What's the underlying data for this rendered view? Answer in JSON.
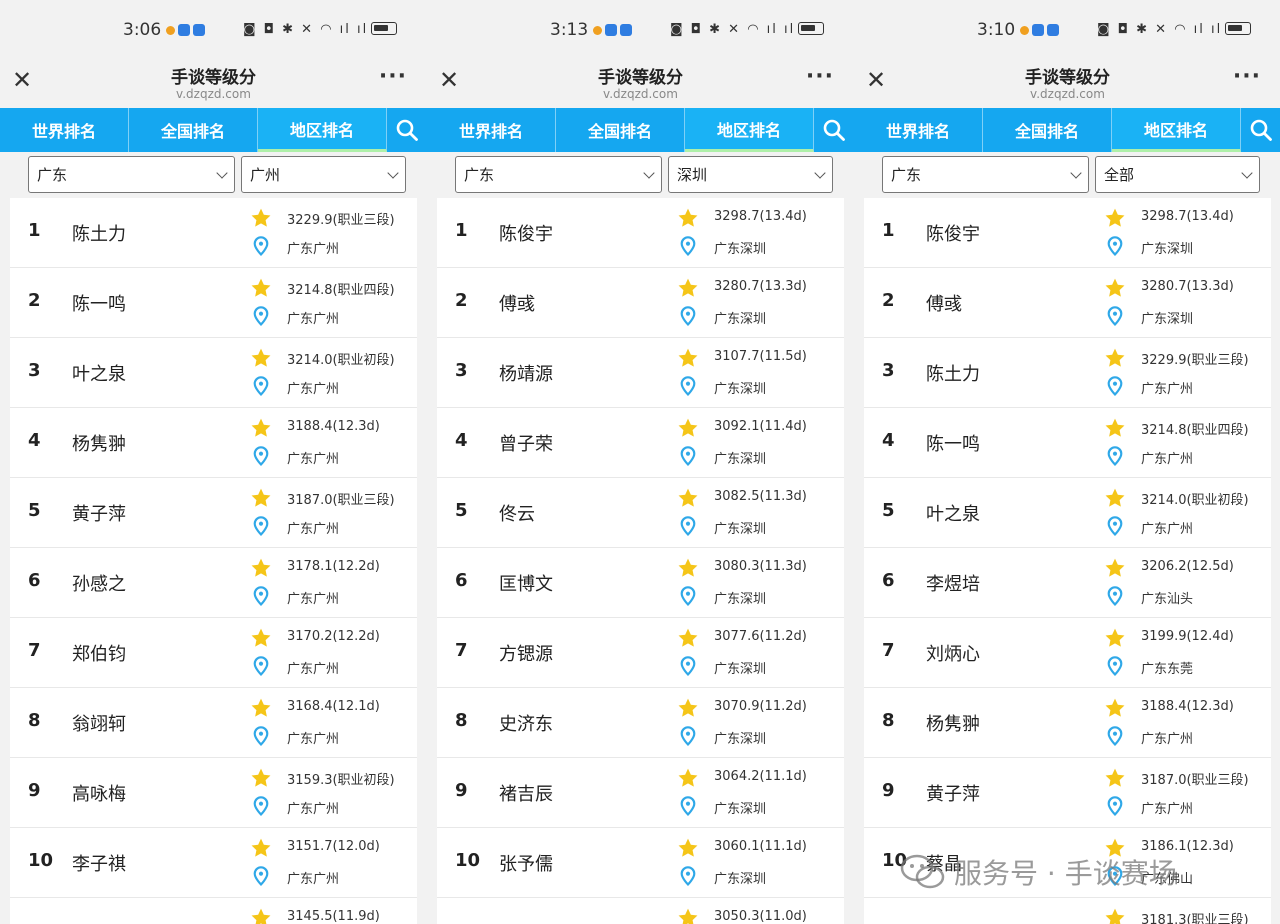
{
  "panels": [
    {
      "status_time": "3:06",
      "title": "手谈等级分",
      "url": "v.dzqzd.com",
      "tabs": [
        "世界排名",
        "全国排名",
        "地区排名"
      ],
      "active_tab": 2,
      "province": "广东",
      "city": "广州",
      "rows": [
        {
          "rank": "1",
          "name": "陈土力",
          "score": "3229.9(职业三段)",
          "loc": "广东广州"
        },
        {
          "rank": "2",
          "name": "陈一鸣",
          "score": "3214.8(职业四段)",
          "loc": "广东广州"
        },
        {
          "rank": "3",
          "name": "叶之泉",
          "score": "3214.0(职业初段)",
          "loc": "广东广州"
        },
        {
          "rank": "4",
          "name": "杨隽翀",
          "score": "3188.4(12.3d)",
          "loc": "广东广州"
        },
        {
          "rank": "5",
          "name": "黄子萍",
          "score": "3187.0(职业三段)",
          "loc": "广东广州"
        },
        {
          "rank": "6",
          "name": "孙感之",
          "score": "3178.1(12.2d)",
          "loc": "广东广州"
        },
        {
          "rank": "7",
          "name": "郑伯钧",
          "score": "3170.2(12.2d)",
          "loc": "广东广州"
        },
        {
          "rank": "8",
          "name": "翁翊轲",
          "score": "3168.4(12.1d)",
          "loc": "广东广州"
        },
        {
          "rank": "9",
          "name": "高咏梅",
          "score": "3159.3(职业初段)",
          "loc": "广东广州"
        },
        {
          "rank": "10",
          "name": "李子祺",
          "score": "3151.7(12.0d)",
          "loc": "广东广州"
        },
        {
          "rank": "",
          "name": "",
          "score": "3145.5(11.9d)",
          "loc": ""
        }
      ]
    },
    {
      "status_time": "3:13",
      "title": "手谈等级分",
      "url": "v.dzqzd.com",
      "tabs": [
        "世界排名",
        "全国排名",
        "地区排名"
      ],
      "active_tab": 2,
      "province": "广东",
      "city": "深圳",
      "rows": [
        {
          "rank": "1",
          "name": "陈俊宇",
          "score": "3298.7(13.4d)",
          "loc": "广东深圳"
        },
        {
          "rank": "2",
          "name": "傅彧",
          "score": "3280.7(13.3d)",
          "loc": "广东深圳"
        },
        {
          "rank": "3",
          "name": "杨靖源",
          "score": "3107.7(11.5d)",
          "loc": "广东深圳"
        },
        {
          "rank": "4",
          "name": "曾子荣",
          "score": "3092.1(11.4d)",
          "loc": "广东深圳"
        },
        {
          "rank": "5",
          "name": "佟云",
          "score": "3082.5(11.3d)",
          "loc": "广东深圳"
        },
        {
          "rank": "6",
          "name": "匡博文",
          "score": "3080.3(11.3d)",
          "loc": "广东深圳"
        },
        {
          "rank": "7",
          "name": "方锶源",
          "score": "3077.6(11.2d)",
          "loc": "广东深圳"
        },
        {
          "rank": "8",
          "name": "史济东",
          "score": "3070.9(11.2d)",
          "loc": "广东深圳"
        },
        {
          "rank": "9",
          "name": "褚吉辰",
          "score": "3064.2(11.1d)",
          "loc": "广东深圳"
        },
        {
          "rank": "10",
          "name": "张予儒",
          "score": "3060.1(11.1d)",
          "loc": "广东深圳"
        },
        {
          "rank": "",
          "name": "",
          "score": "3050.3(11.0d)",
          "loc": ""
        }
      ]
    },
    {
      "status_time": "3:10",
      "title": "手谈等级分",
      "url": "v.dzqzd.com",
      "tabs": [
        "世界排名",
        "全国排名",
        "地区排名"
      ],
      "active_tab": 2,
      "province": "广东",
      "city": "全部",
      "rows": [
        {
          "rank": "1",
          "name": "陈俊宇",
          "score": "3298.7(13.4d)",
          "loc": "广东深圳"
        },
        {
          "rank": "2",
          "name": "傅彧",
          "score": "3280.7(13.3d)",
          "loc": "广东深圳"
        },
        {
          "rank": "3",
          "name": "陈土力",
          "score": "3229.9(职业三段)",
          "loc": "广东广州"
        },
        {
          "rank": "4",
          "name": "陈一鸣",
          "score": "3214.8(职业四段)",
          "loc": "广东广州"
        },
        {
          "rank": "5",
          "name": "叶之泉",
          "score": "3214.0(职业初段)",
          "loc": "广东广州"
        },
        {
          "rank": "6",
          "name": "李煜培",
          "score": "3206.2(12.5d)",
          "loc": "广东汕头"
        },
        {
          "rank": "7",
          "name": "刘炳心",
          "score": "3199.9(12.4d)",
          "loc": "广东东莞"
        },
        {
          "rank": "8",
          "name": "杨隽翀",
          "score": "3188.4(12.3d)",
          "loc": "广东广州"
        },
        {
          "rank": "9",
          "name": "黄子萍",
          "score": "3187.0(职业三段)",
          "loc": "广东广州"
        },
        {
          "rank": "10",
          "name": "蔡晶",
          "score": "3186.1(12.3d)",
          "loc": "广东佛山"
        },
        {
          "rank": "",
          "name": "",
          "score": "3181.3(职业三段)",
          "loc": ""
        }
      ]
    }
  ],
  "watermark": "服务号 · 手谈赛场",
  "colors": {
    "tab_bar": "#15a7f0",
    "star": "#f5c518",
    "pin": "#2fa8e8"
  }
}
